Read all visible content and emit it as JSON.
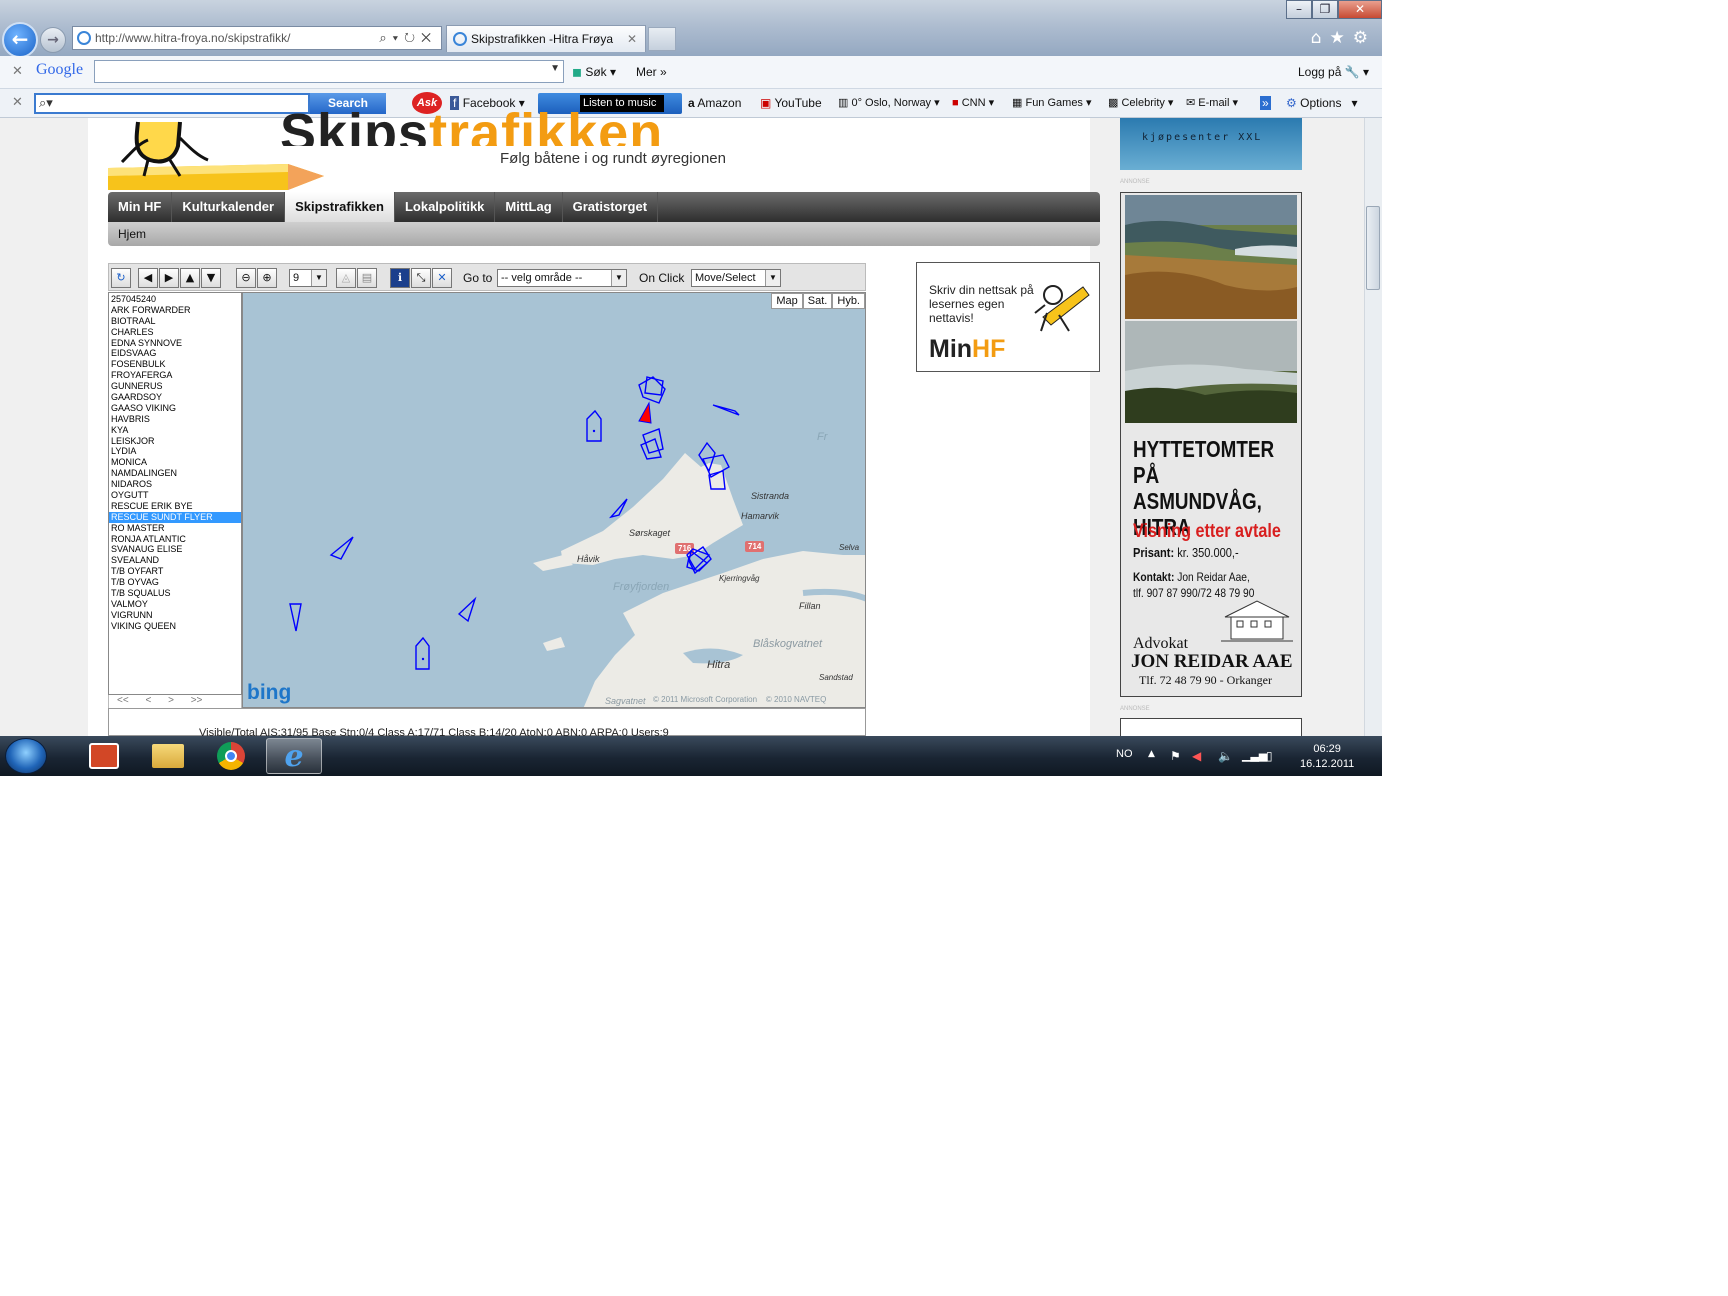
{
  "browser": {
    "url": "http://www.hitra-froya.no/skipstrafikk/",
    "tab_title": "Skipstrafikken -Hitra Frøya"
  },
  "google_toolbar": {
    "logo": "Google",
    "search_button": "Søk",
    "more": "Mer",
    "login": "Logg på"
  },
  "ask_toolbar": {
    "search_button": "Search",
    "ask_logo": "Ask",
    "items": [
      "Facebook",
      "Listen to music",
      "Amazon",
      "YouTube",
      "0° Oslo, Norway",
      "CNN",
      "Fun Games",
      "Celebrity",
      "E-mail",
      "Options"
    ]
  },
  "site": {
    "title_dark": "Skips",
    "title_orange": "trafikken",
    "tagline": "Følg båtene i og rundt øyregionen",
    "nav": [
      "Min HF",
      "Kulturkalender",
      "Skipstrafikken",
      "Lokalpolitikk",
      "MittLag",
      "Gratistorget"
    ],
    "nav_active": "Skipstrafikken",
    "breadcrumb": "Hjem"
  },
  "map_toolbar": {
    "zoom_value": "9",
    "goto_label": "Go to",
    "goto_value": "-- velg område --",
    "onclick_label": "On Click",
    "onclick_value": "Move/Select"
  },
  "ships": [
    "257045240",
    "ARK FORWARDER",
    "BIOTRAAL",
    "CHARLES",
    "EDNA SYNNOVE",
    "EIDSVAAG",
    "FOSENBULK",
    "FROYAFERGA",
    "GUNNERUS",
    "GAARDSOY",
    "GAASO VIKING",
    "HAVBRIS",
    "KYA",
    "LEISKJOR",
    "LYDIA",
    "MONICA",
    "NAMDALINGEN",
    "NIDAROS",
    "OYGUTT",
    "RESCUE ERIK BYE",
    "RESCUE SUNDT FLYER",
    "RO MASTER",
    "RONJA ATLANTIC",
    "SVANAUG ELISE",
    "SVEALAND",
    "T/B OYFART",
    "T/B OYVAG",
    "T/B SQUALUS",
    "VALMOY",
    "VIGRUNN",
    "VIKING QUEEN"
  ],
  "selected_ship": "RESCUE SUNDT FLYER",
  "list_nav": "<< < > >>",
  "map": {
    "types": [
      "Map",
      "Sat.",
      "Hyb."
    ],
    "provider": "bing",
    "places": [
      "Sørskaget",
      "Håvik",
      "Frøyfjorden",
      "Sistranda",
      "Hamarvik",
      "Kjerringvåg",
      "Fillan",
      "Blåskogvatnet",
      "Hitra",
      "Sandstad",
      "Sagvatnet",
      "Selva",
      "Fr"
    ],
    "roads": [
      "716",
      "714"
    ],
    "copyright": "© 2011 Microsoft Corporation    © 2010 NAVTEQ"
  },
  "status": "Visible/Total AIS:31/95  Base Stn:0/4  Class A:17/71  Class B:14/20  AtoN:0  ABN:0  ARPA:0  Users:9",
  "minhf_ad": {
    "text": "Skriv din nettsak på lesernes egen nettavis!",
    "brand_dark": "Min",
    "brand_orange": "HF"
  },
  "ad_top": {
    "text": "kjøpesenter XXL"
  },
  "annonse": "ANNONSE",
  "ad_big": {
    "headline": [
      "HYTTETOMTER",
      "PÅ ASMUNDVÅG,",
      "HITRA"
    ],
    "viewing": "Visning etter avtale",
    "price_label": "Prisant:",
    "price": "kr. 350.000,-",
    "contact_label": "Kontakt:",
    "contact_name": "Jon Reidar Aae,",
    "contact_phone": "tlf. 907 87 990/72 48 79 90",
    "lawyer_title": "Advokat",
    "lawyer_name": "JON REIDAR AAE",
    "lawyer_phone": "Tlf. 72 48 79 90 - Orkanger"
  },
  "taskbar": {
    "language": "NO",
    "time": "06:29",
    "date": "16.12.2011"
  },
  "colors": {
    "accent_orange": "#f39c12",
    "ship_blue": "#0000ff",
    "selected_red": "#ff0000",
    "ad_red": "#d81e1e"
  }
}
